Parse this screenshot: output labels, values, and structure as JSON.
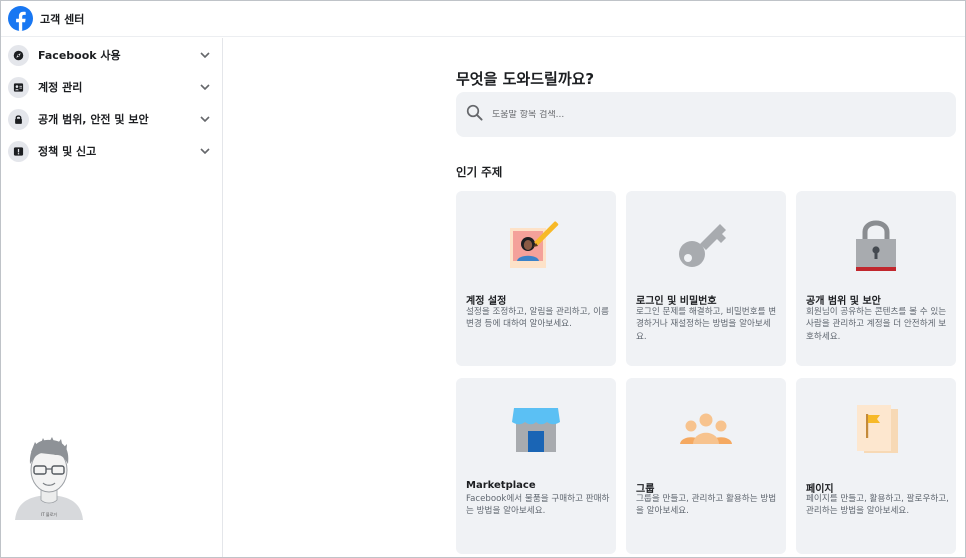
{
  "header": {
    "title": "고객 센터",
    "logo_icon": "facebook-logo-icon"
  },
  "sidebar": {
    "items": [
      {
        "label": "Facebook 사용",
        "icon": "compass-icon"
      },
      {
        "label": "계정 관리",
        "icon": "profile-card-icon"
      },
      {
        "label": "공개 범위, 안전 및 보안",
        "icon": "lock-icon"
      },
      {
        "label": "정책 및 신고",
        "icon": "alert-icon"
      }
    ],
    "avatar_caption": "IT 블로거"
  },
  "main": {
    "heading": "무엇을 도와드릴까요?",
    "search": {
      "placeholder": "도움말 항목 검색..."
    },
    "popular_title": "인기 주제",
    "cards": [
      {
        "title": "계정 설정",
        "desc": "설정을 조정하고, 알림을 관리하고, 이름 변경 등에 대하여 알아보세요.",
        "icon": "profile-photo-icon"
      },
      {
        "title": "로그인 및 비밀번호",
        "desc": "로그인 문제를 해결하고, 비밀번호를 변경하거나 재설정하는 방법을 알아보세요.",
        "icon": "key-icon"
      },
      {
        "title": "공개 범위 및 보안",
        "desc": "회원님이 공유하는 콘텐츠를 볼 수 있는 사람을 관리하고 계정을 더 안전하게 보호하세요.",
        "icon": "padlock-icon"
      },
      {
        "title": "Marketplace",
        "desc": "Facebook에서 물품을 구매하고 판매하는 방법을 알아보세요.",
        "icon": "shop-icon"
      },
      {
        "title": "그룹",
        "desc": "그룹을 만들고, 관리하고 활용하는 방법을 알아보세요.",
        "icon": "people-group-icon"
      },
      {
        "title": "페이지",
        "desc": "페이지를 만들고, 활용하고, 팔로우하고, 관리하는 방법을 알아보세요.",
        "icon": "page-flag-icon"
      }
    ]
  },
  "colors": {
    "brand": "#1877f2",
    "card_bg": "#f0f2f5",
    "text": "#1c1e21",
    "muted": "#606770"
  }
}
